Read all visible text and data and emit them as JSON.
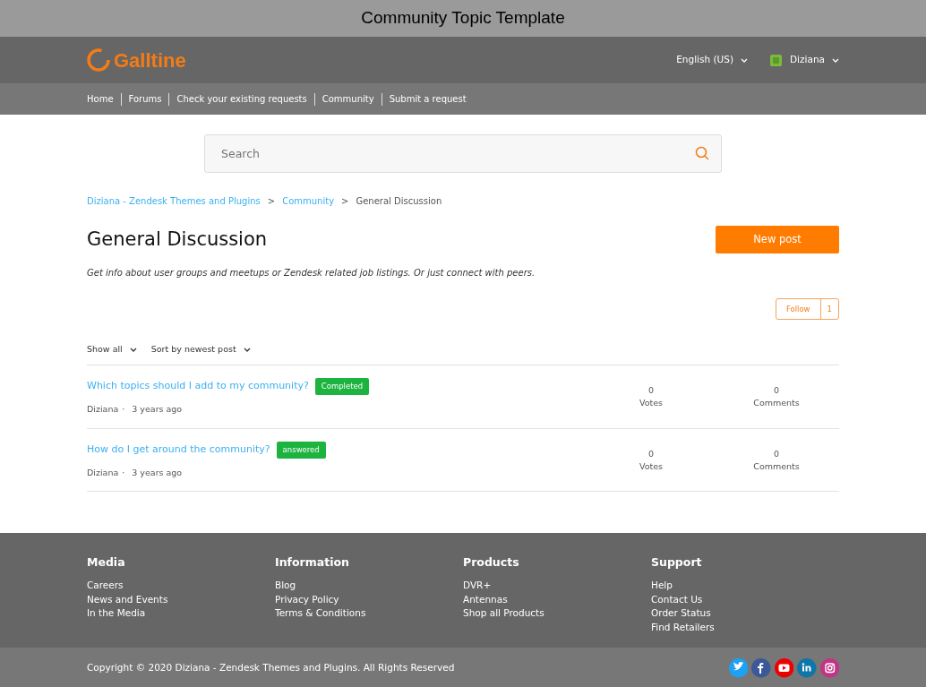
{
  "window": {
    "title": "Community Topic Template"
  },
  "header": {
    "logo": "Galltine",
    "language": "English (US)",
    "user": "Diziana"
  },
  "nav": [
    "Home",
    "Forums",
    "Check your existing requests",
    "Community",
    "Submit a request"
  ],
  "search": {
    "placeholder": "Search"
  },
  "breadcrumbs": [
    {
      "label": "Diziana - Zendesk Themes and Plugins",
      "link": true,
      "separator": ">"
    },
    {
      "label": "Community",
      "link": true,
      "separator": ">"
    },
    {
      "label": "General Discussion",
      "link": false
    }
  ],
  "page": {
    "title": "General Discussion",
    "description": "Get info about user groups and meetups or Zendesk related job listings. Or just connect with peers.",
    "new_post": "New post",
    "follow": "Follow",
    "follow_count": "1"
  },
  "filters": [
    "Show all",
    "Sort by newest post"
  ],
  "posts": [
    {
      "title": "Which topics should I add to my community?",
      "status": "Completed",
      "author": "Diziana",
      "separator": "·",
      "time": "3 years ago",
      "votes": "0",
      "votes_label": "Votes",
      "comments": "0",
      "comments_label": "Comments"
    },
    {
      "title": "How do I get around the community?",
      "status": "answered",
      "author": "Diziana",
      "separator": "·",
      "time": "3 years ago",
      "votes": "0",
      "votes_label": "Votes",
      "comments": "0",
      "comments_label": "Comments"
    }
  ],
  "footer": {
    "columns": [
      {
        "heading": "Media",
        "links": [
          "Careers",
          "News and Events",
          "In the Media"
        ]
      },
      {
        "heading": "Information",
        "links": [
          "Blog",
          "Privacy Policy",
          "Terms & Conditions"
        ]
      },
      {
        "heading": "Products",
        "links": [
          "DVR+",
          "Antennas",
          "Shop all Products"
        ]
      },
      {
        "heading": "Support",
        "links": [
          "Help",
          "Contact Us",
          "Order Status",
          "Find Retailers"
        ]
      }
    ],
    "copyright": "Copyright © 2020 Diziana - Zendesk Themes and Plugins. All Rights Reserved",
    "social": [
      {
        "kind": "twitter"
      },
      {
        "kind": "facebook"
      },
      {
        "kind": "youtube"
      },
      {
        "kind": "linkedin"
      },
      {
        "kind": "instagram"
      }
    ]
  }
}
